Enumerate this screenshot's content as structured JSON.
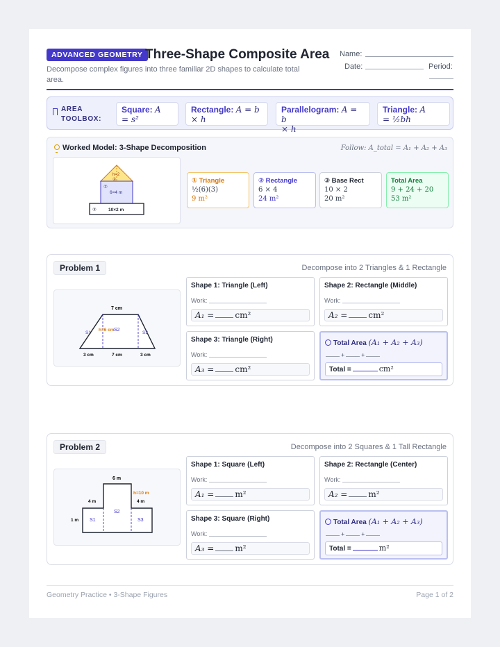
{
  "header": {
    "badge": "ADVANCED GEOMETRY",
    "title": "Three-Shape Composite Area",
    "subtitle": "Decompose complex figures into three familiar 2D shapes to calculate total area.",
    "name_label": "Name:",
    "date_label": "Date:",
    "period_label": "Period:"
  },
  "toolbox": {
    "label": "AREA TOOLBOX:",
    "items": [
      {
        "name": "Square:",
        "formula_1": "A",
        "formula_2": "= s²"
      },
      {
        "name": "Rectangle:",
        "formula_1": "A = b",
        "formula_2": "× h"
      },
      {
        "name": "Parallelogram:",
        "formula_1": "A = b",
        "formula_2": "× h"
      },
      {
        "name": "Triangle:",
        "formula_1": "A",
        "formula_2": "= ½bh"
      }
    ]
  },
  "worked": {
    "title": "Worked Model: 3-Shape Decomposition",
    "follow": "Follow: A_total = A₁ + A₂ + A₃",
    "figure": {
      "tri_label": "h=2",
      "tri_num": "①",
      "rect_num": "②",
      "rect_label": "6×4 m",
      "base_num": "③",
      "base_label": "10×2 m"
    },
    "cards": [
      {
        "head": "① Triangle",
        "calc": "½(6)(3)",
        "result": "9 m²",
        "color": "#d97706"
      },
      {
        "head": "② Rectangle",
        "calc": "6 × 4",
        "result": "24 m²",
        "color": "#4338ca"
      },
      {
        "head": "③ Base Rect",
        "calc": "10 × 2",
        "result": "20 m²",
        "color": "#1f2430"
      },
      {
        "head": "Total Area",
        "calc": "9 + 24 + 20",
        "result": "53 m²",
        "color": "#15803d"
      }
    ]
  },
  "problems": [
    {
      "label": "Problem 1",
      "hint": "Decompose into 2 Triangles & 1 Rectangle",
      "figure": {
        "top": "7 cm",
        "h": "h=6 cm",
        "s1": "S1",
        "s2": "S2",
        "s3": "S3",
        "b1": "3 cm",
        "b2": "7 cm",
        "b3": "3 cm"
      },
      "shapes": [
        {
          "title": "Shape 1: Triangle (Left)",
          "work": "Work:",
          "var": "A₁ =",
          "unit": "cm²"
        },
        {
          "title": "Shape 2: Rectangle (Middle)",
          "work": "Work:",
          "var": "A₂ =",
          "unit": "cm²"
        },
        {
          "title": "Shape 3: Triangle (Right)",
          "work": "Work:",
          "var": "A₃ =",
          "unit": "cm²"
        }
      ],
      "total": {
        "head": "Total Area",
        "formula": "(A₁ + A₂ + A₃)",
        "plus": "+",
        "label": "Total =",
        "unit": "cm²"
      }
    },
    {
      "label": "Problem 2",
      "hint": "Decompose into 2 Squares & 1 Tall Rectangle",
      "figure": {
        "top": "6 m",
        "h": "h=10 m",
        "l": "4 m",
        "r": "4 m",
        "side": "1 m",
        "s1": "S1",
        "s2": "S2",
        "s3": "S3"
      },
      "shapes": [
        {
          "title": "Shape 1: Square (Left)",
          "work": "Work:",
          "var": "A₁ =",
          "unit": "m²"
        },
        {
          "title": "Shape 2: Rectangle (Center)",
          "work": "Work:",
          "var": "A₂ =",
          "unit": "m²"
        },
        {
          "title": "Shape 3: Square (Right)",
          "work": "Work:",
          "var": "A₃ =",
          "unit": "m²"
        }
      ],
      "total": {
        "head": "Total Area",
        "formula": "(A₁ + A₂ + A₃)",
        "plus": "+",
        "label": "Total =",
        "unit": "m²"
      }
    }
  ],
  "footer": {
    "left": "Geometry Practice • 3-Shape Figures",
    "right": "Page 1 of 2"
  },
  "colors": {
    "accent": "#4338ca",
    "orange": "#d97706",
    "green": "#15803d"
  }
}
